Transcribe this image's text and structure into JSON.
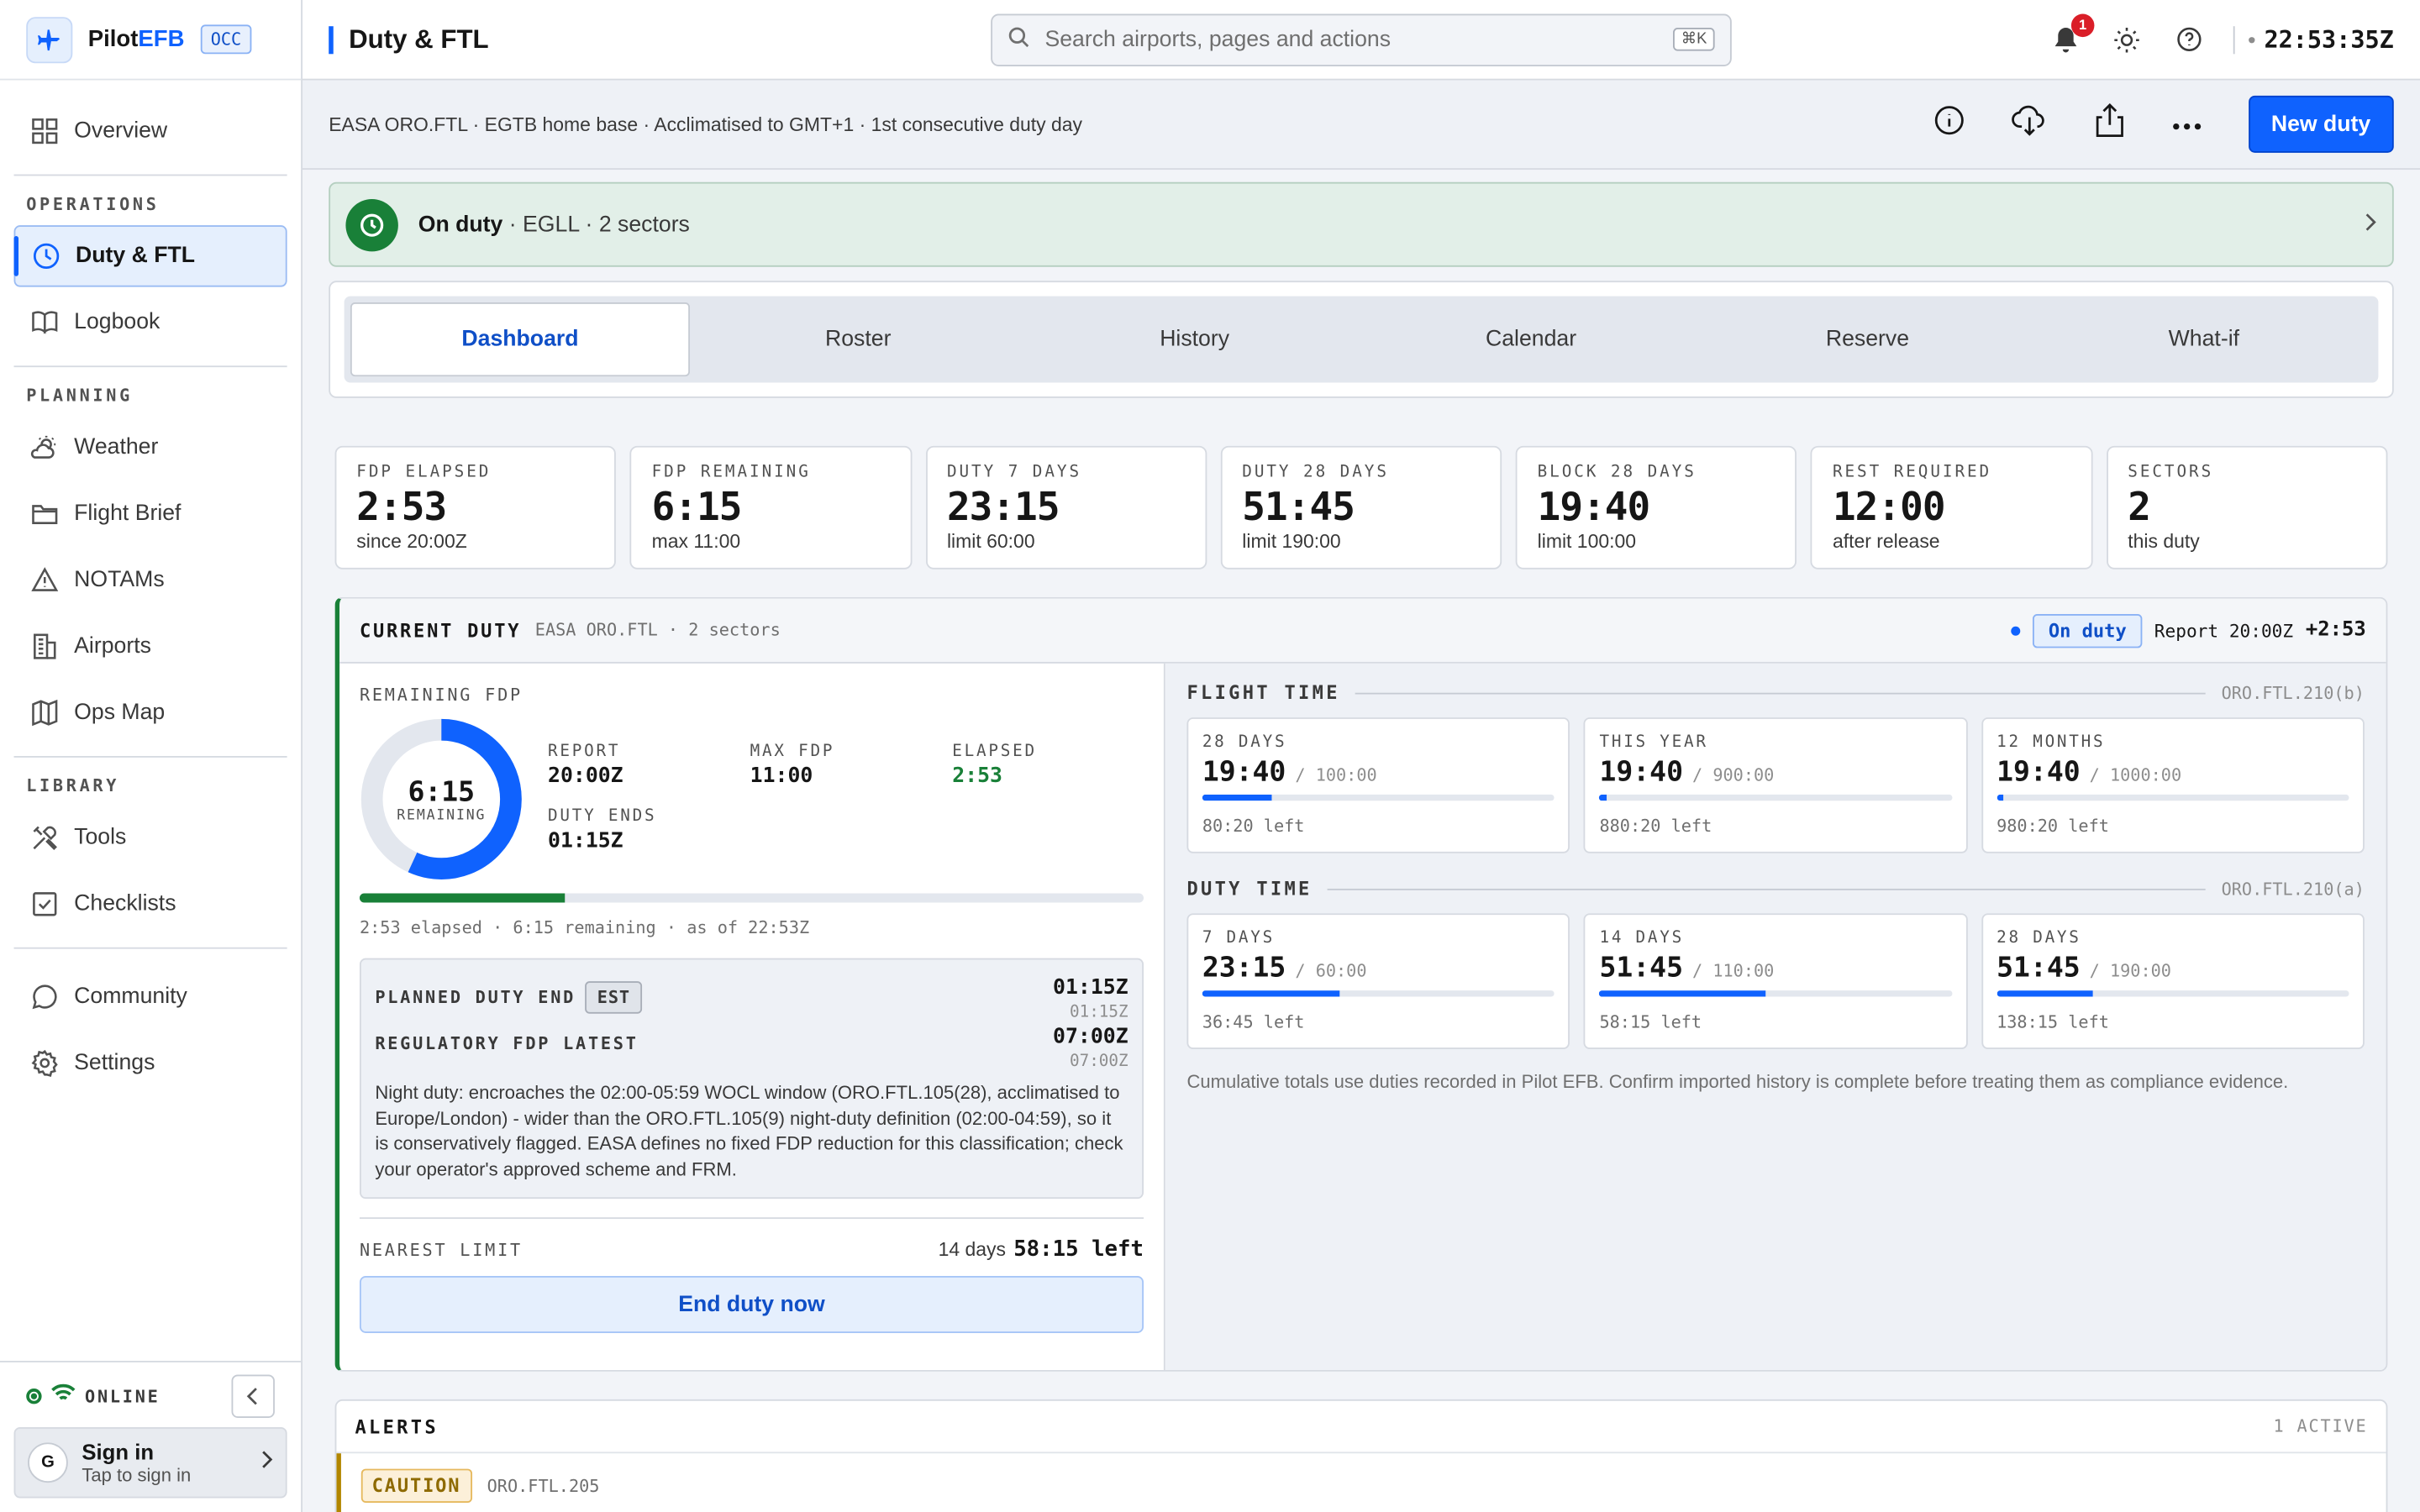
{
  "brand": {
    "name_plain": "Pilot",
    "name_accent": "EFB",
    "badge": "OCC"
  },
  "sidebar": {
    "top_items": [
      {
        "label": "Overview",
        "icon": "grid-icon"
      }
    ],
    "sections": [
      {
        "title": "OPERATIONS",
        "items": [
          {
            "label": "Duty & FTL",
            "icon": "clock-icon",
            "active": true
          },
          {
            "label": "Logbook",
            "icon": "book-icon"
          }
        ]
      },
      {
        "title": "PLANNING",
        "items": [
          {
            "label": "Weather",
            "icon": "weather-icon"
          },
          {
            "label": "Flight Brief",
            "icon": "folder-icon"
          },
          {
            "label": "NOTAMs",
            "icon": "warning-icon"
          },
          {
            "label": "Airports",
            "icon": "building-icon"
          },
          {
            "label": "Ops Map",
            "icon": "map-icon"
          }
        ]
      },
      {
        "title": "LIBRARY",
        "items": [
          {
            "label": "Tools",
            "icon": "tools-icon"
          },
          {
            "label": "Checklists",
            "icon": "checkbox-icon"
          }
        ]
      }
    ],
    "bottom_items": [
      {
        "label": "Community",
        "icon": "chat-icon"
      },
      {
        "label": "Settings",
        "icon": "gear-icon"
      }
    ],
    "status": "ONLINE",
    "signin": {
      "avatar": "G",
      "title": "Sign in",
      "subtitle": "Tap to sign in"
    }
  },
  "topbar": {
    "title": "Duty & FTL",
    "search_placeholder": "Search airports, pages and actions",
    "search_shortcut": "⌘K",
    "notification_count": "1",
    "clock": "22:53:35Z"
  },
  "subbar": {
    "context": "EASA ORO.FTL · EGTB home base · Acclimatised to GMT+1 · 1st consecutive duty day",
    "new_duty_label": "New duty"
  },
  "banner": {
    "status": "On duty",
    "detail": " · EGLL · 2 sectors"
  },
  "tabs": [
    {
      "label": "Dashboard",
      "active": true
    },
    {
      "label": "Roster"
    },
    {
      "label": "History"
    },
    {
      "label": "Calendar"
    },
    {
      "label": "Reserve"
    },
    {
      "label": "What-if"
    }
  ],
  "stats": [
    {
      "label": "FDP ELAPSED",
      "value": "2:53",
      "sub": "since 20:00Z"
    },
    {
      "label": "FDP REMAINING",
      "value": "6:15",
      "sub": "max 11:00"
    },
    {
      "label": "DUTY 7 DAYS",
      "value": "23:15",
      "sub": "limit 60:00"
    },
    {
      "label": "DUTY 28 DAYS",
      "value": "51:45",
      "sub": "limit 190:00"
    },
    {
      "label": "BLOCK 28 DAYS",
      "value": "19:40",
      "sub": "limit 100:00"
    },
    {
      "label": "REST REQUIRED",
      "value": "12:00",
      "sub": "after release"
    },
    {
      "label": "SECTORS",
      "value": "2",
      "sub": "this duty"
    }
  ],
  "current_duty": {
    "title": "CURRENT DUTY",
    "subtitle": "EASA ORO.FTL · 2 sectors",
    "pill": "On duty",
    "report_text": "Report 20:00Z",
    "elapsed_badge": "+2:53",
    "remaining_label": "REMAINING FDP",
    "gauge_value": "6:15",
    "gauge_sub": "REMAINING",
    "gauge_remaining_fraction": 0.568,
    "kv": [
      {
        "label": "REPORT",
        "value": "20:00Z"
      },
      {
        "label": "MAX FDP",
        "value": "11:00"
      },
      {
        "label": "ELAPSED",
        "value": "2:53",
        "green": true
      },
      {
        "label": "DUTY ENDS",
        "value": "01:15Z"
      }
    ],
    "progress_fraction": 0.262,
    "progress_caption": "2:53 elapsed · 6:15 remaining · as of 22:53Z",
    "planned_end_label": "PLANNED DUTY END",
    "planned_end_badge": "EST",
    "planned_end_value": "01:15Z",
    "planned_end_sub": "01:15Z",
    "reg_fdp_label": "REGULATORY FDP LATEST",
    "reg_fdp_value": "07:00Z",
    "reg_fdp_sub": "07:00Z",
    "note": "Night duty: encroaches the 02:00-05:59 WOCL window (ORO.FTL.105(28), acclimatised to Europe/London) - wider than the ORO.FTL.105(9) night-duty definition (02:00-04:59), so it is conservatively flagged. EASA defines no fixed FDP reduction for this classification; check your operator's approved scheme and FRM.",
    "nearest_label": "NEAREST LIMIT",
    "nearest_period": "14 days",
    "nearest_value": "58:15 left",
    "end_duty_label": "End duty now"
  },
  "flight_time": {
    "title": "FLIGHT TIME",
    "ref": "ORO.FTL.210(b)",
    "cards": [
      {
        "label": "28 DAYS",
        "value": "19:40",
        "limit": "/ 100:00",
        "left": "80:20 left",
        "fraction": 0.197
      },
      {
        "label": "THIS YEAR",
        "value": "19:40",
        "limit": "/ 900:00",
        "left": "880:20 left",
        "fraction": 0.022
      },
      {
        "label": "12 MONTHS",
        "value": "19:40",
        "limit": "/ 1000:00",
        "left": "980:20 left",
        "fraction": 0.02
      }
    ]
  },
  "duty_time": {
    "title": "DUTY TIME",
    "ref": "ORO.FTL.210(a)",
    "cards": [
      {
        "label": "7 DAYS",
        "value": "23:15",
        "limit": "/ 60:00",
        "left": "36:45 left",
        "fraction": 0.388
      },
      {
        "label": "14 DAYS",
        "value": "51:45",
        "limit": "/ 110:00",
        "left": "58:15 left",
        "fraction": 0.47
      },
      {
        "label": "28 DAYS",
        "value": "51:45",
        "limit": "/ 190:00",
        "left": "138:15 left",
        "fraction": 0.272
      }
    ]
  },
  "footnote": "Cumulative totals use duties recorded in Pilot EFB. Confirm imported history is complete before treating them as compliance evidence.",
  "alerts": {
    "title": "ALERTS",
    "count": "1 ACTIVE",
    "items": [
      {
        "level": "CAUTION",
        "ref": "ORO.FTL.205"
      }
    ]
  },
  "colors": {
    "accent": "#0f62fe",
    "ok": "#198038",
    "caution": "#b28600",
    "danger": "#da1e28"
  }
}
